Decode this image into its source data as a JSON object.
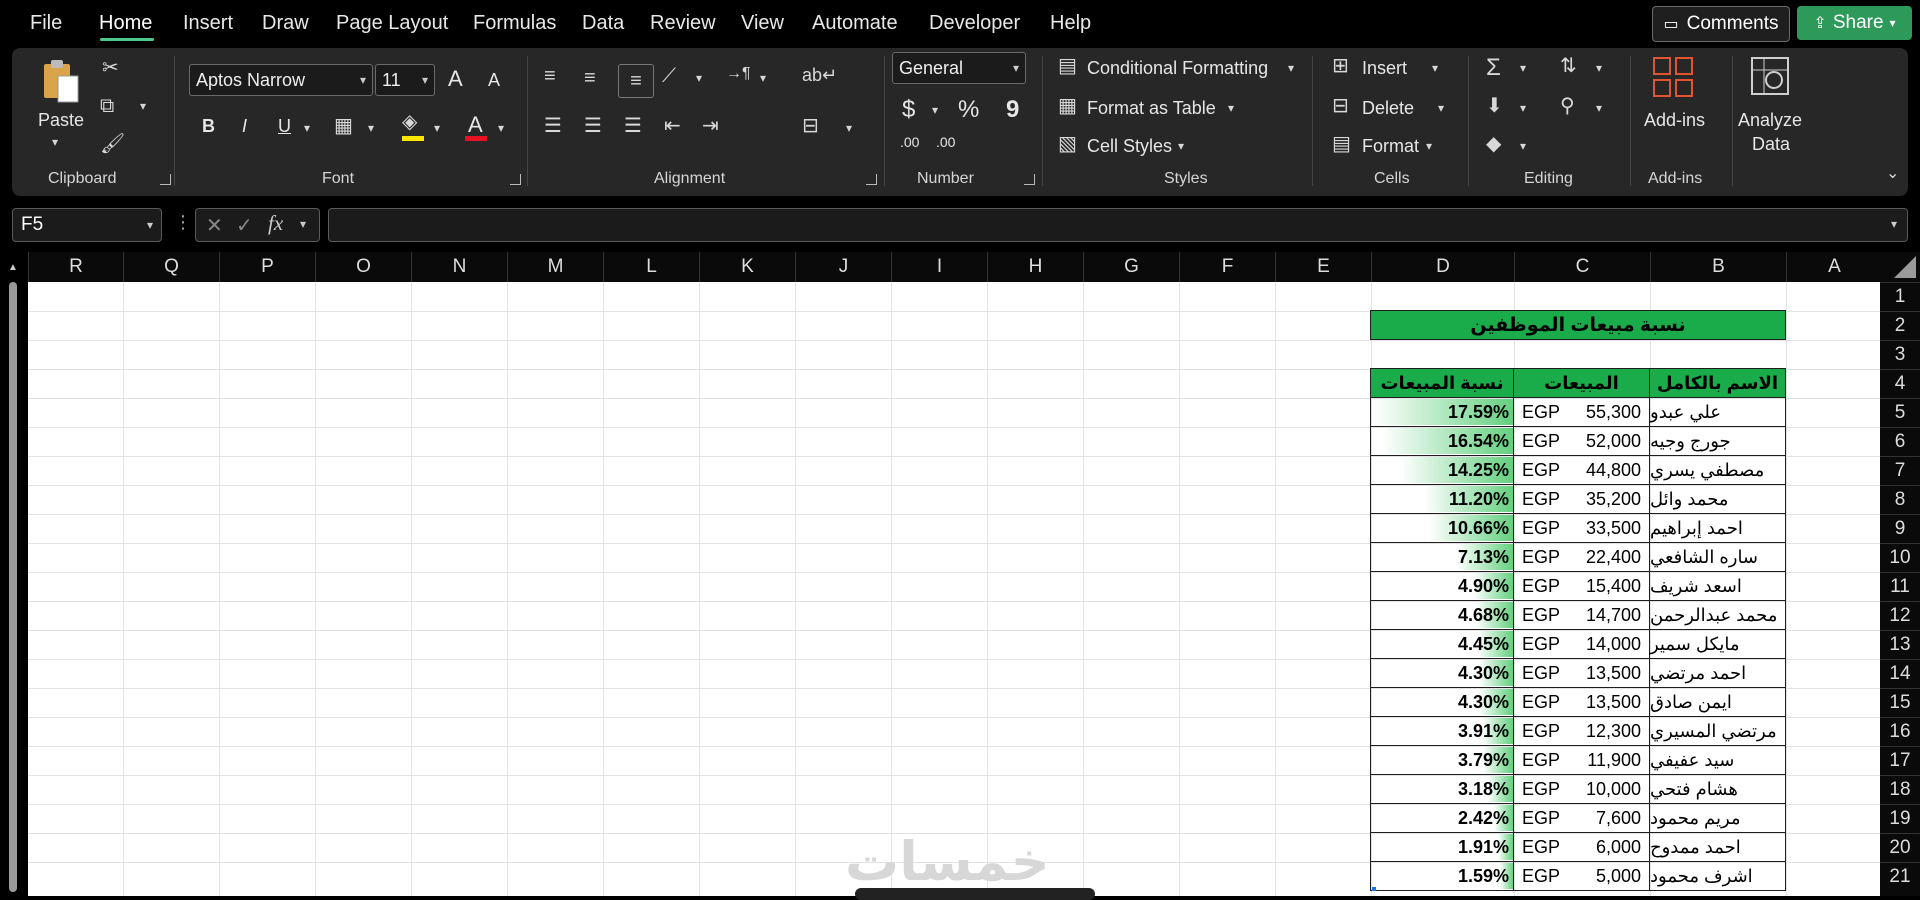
{
  "menu": {
    "items": [
      "File",
      "Home",
      "Insert",
      "Draw",
      "Page Layout",
      "Formulas",
      "Data",
      "Review",
      "View",
      "Automate",
      "Developer",
      "Help"
    ],
    "comments_label": "Comments",
    "share_label": "Share"
  },
  "ribbon": {
    "clipboard": {
      "paste_label": "Paste",
      "group_label": "Clipboard"
    },
    "font": {
      "family": "Aptos Narrow",
      "size": "11",
      "group_label": "Font",
      "bold": "B",
      "italic": "I",
      "underline": "U",
      "grow": "A",
      "shrink": "A",
      "font_color_letter": "A"
    },
    "alignment": {
      "group_label": "Alignment"
    },
    "number": {
      "format": "General",
      "group_label": "Number",
      "currency": "$",
      "percent": "%",
      "comma": "9",
      "inc_decimal": ".00",
      "dec_decimal": ".00"
    },
    "styles": {
      "conditional": "Conditional Formatting",
      "format_table": "Format as Table",
      "cell_styles": "Cell Styles",
      "group_label": "Styles"
    },
    "cells": {
      "insert": "Insert",
      "delete": "Delete",
      "format": "Format",
      "group_label": "Cells"
    },
    "editing": {
      "group_label": "Editing"
    },
    "addins": {
      "label": "Add-ins",
      "group_label": "Add-ins"
    },
    "analyze": {
      "line1": "Analyze",
      "line2": "Data"
    }
  },
  "formula_bar": {
    "name_box": "F5",
    "formula": ""
  },
  "columns": [
    "R",
    "Q",
    "P",
    "O",
    "N",
    "M",
    "L",
    "K",
    "J",
    "I",
    "H",
    "G",
    "F",
    "E",
    "D",
    "C",
    "B",
    "A"
  ],
  "rows": [
    "1",
    "2",
    "3",
    "4",
    "5",
    "6",
    "7",
    "8",
    "9",
    "10",
    "11",
    "12",
    "13",
    "14",
    "15",
    "16",
    "17",
    "18",
    "19",
    "20",
    "21"
  ],
  "table": {
    "title": "نسبة مبيعات الموظفين",
    "headers": {
      "name": "الاسم بالكامل",
      "sales": "المبيعات",
      "pct": "نسبة المبيعات"
    },
    "currency": "EGP",
    "rows": [
      {
        "name": "علي عبدو",
        "sales": "55,300",
        "pct": "17.59%",
        "fraction": 0.1759
      },
      {
        "name": "جورج وجيه",
        "sales": "52,000",
        "pct": "16.54%",
        "fraction": 0.1654
      },
      {
        "name": "مصطفي يسري",
        "sales": "44,800",
        "pct": "14.25%",
        "fraction": 0.1425
      },
      {
        "name": "محمد وائل",
        "sales": "35,200",
        "pct": "11.20%",
        "fraction": 0.112
      },
      {
        "name": "احمد إبراهيم",
        "sales": "33,500",
        "pct": "10.66%",
        "fraction": 0.1066
      },
      {
        "name": "ساره الشافعي",
        "sales": "22,400",
        "pct": "7.13%",
        "fraction": 0.0713
      },
      {
        "name": "اسعد شريف",
        "sales": "15,400",
        "pct": "4.90%",
        "fraction": 0.049
      },
      {
        "name": "محمد عبدالرحمن",
        "sales": "14,700",
        "pct": "4.68%",
        "fraction": 0.0468
      },
      {
        "name": "مايكل سمير",
        "sales": "14,000",
        "pct": "4.45%",
        "fraction": 0.0445
      },
      {
        "name": "احمد مرتضي",
        "sales": "13,500",
        "pct": "4.30%",
        "fraction": 0.043
      },
      {
        "name": "ايمن  صادق",
        "sales": "13,500",
        "pct": "4.30%",
        "fraction": 0.043
      },
      {
        "name": "مرتضي المسيري",
        "sales": "12,300",
        "pct": "3.91%",
        "fraction": 0.0391
      },
      {
        "name": "سيد عفيفي",
        "sales": "11,900",
        "pct": "3.79%",
        "fraction": 0.0379
      },
      {
        "name": "هشام فتحي",
        "sales": "10,000",
        "pct": "3.18%",
        "fraction": 0.0318
      },
      {
        "name": "مريم محمود",
        "sales": "7,600",
        "pct": "2.42%",
        "fraction": 0.0242
      },
      {
        "name": "احمد ممدوح",
        "sales": "6,000",
        "pct": "1.91%",
        "fraction": 0.0191
      },
      {
        "name": "اشرف محمود",
        "sales": "5,000",
        "pct": "1.59%",
        "fraction": 0.0159
      }
    ]
  },
  "colors": {
    "header_green": "#1aab4b",
    "bar_green": "#63d07f",
    "accent": "#2e9a5a"
  },
  "watermark": "خمسات"
}
